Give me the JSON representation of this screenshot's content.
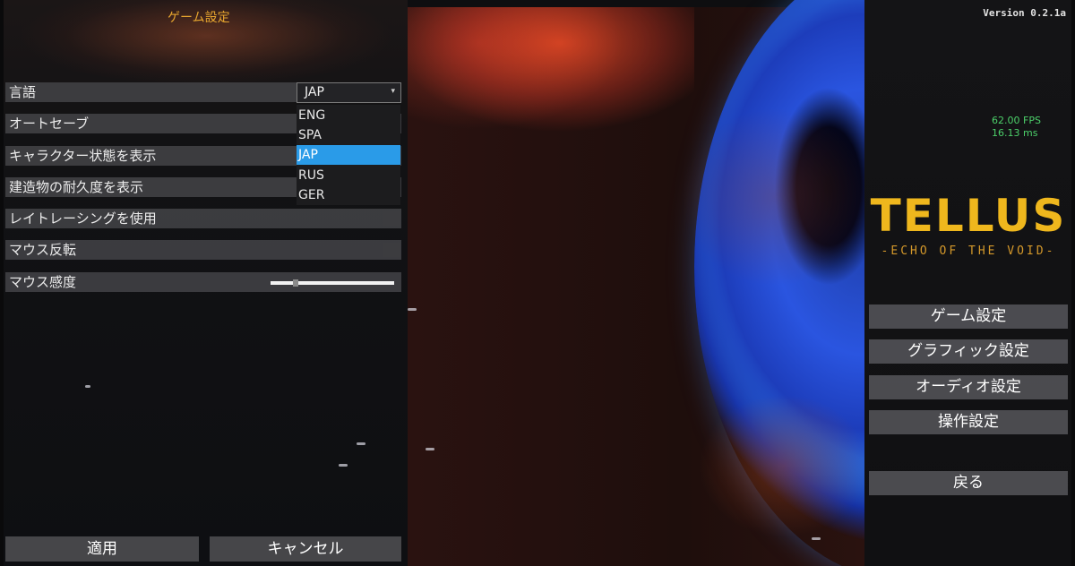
{
  "settings_panel": {
    "title": "ゲーム設定",
    "rows": [
      {
        "label": "言語",
        "control": "dropdown"
      },
      {
        "label": "オートセーブ",
        "control": "checkbox"
      },
      {
        "label": "キャラクター状態を表示",
        "control": "checkbox"
      },
      {
        "label": "建造物の耐久度を表示",
        "control": "checkbox"
      },
      {
        "label": "レイトレーシングを使用",
        "control": "checkbox"
      },
      {
        "label": "マウス反転",
        "control": "checkbox"
      },
      {
        "label": "マウス感度",
        "control": "slider"
      }
    ],
    "language_dropdown": {
      "selected": "JAP",
      "options": [
        "ENG",
        "SPA",
        "JAP",
        "RUS",
        "GER"
      ],
      "highlighted_index": 2
    },
    "mouse_sensitivity": 0.2,
    "apply_label": "適用",
    "cancel_label": "キャンセル"
  },
  "hud": {
    "version": "Version 0.2.1a",
    "fps": "62.00 FPS",
    "frame_time": "16.13 ms"
  },
  "logo": {
    "title": "TELLUS",
    "subtitle": "-ECHO OF THE VOID-"
  },
  "main_menu": {
    "items": [
      "ゲーム設定",
      "グラフィック設定",
      "オーディオ設定",
      "操作設定"
    ],
    "back_label": "戻る"
  },
  "colors": {
    "accent": "#e6a52f",
    "highlight": "#2a9be8",
    "fps_text": "#4cd06a",
    "logo": "#efb71d"
  }
}
